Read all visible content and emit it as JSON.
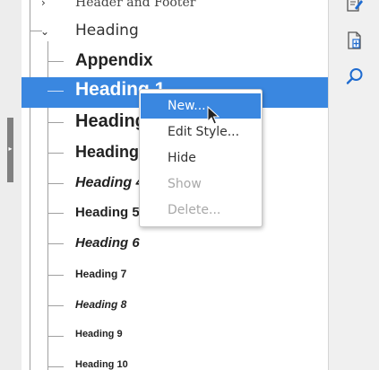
{
  "tree": {
    "parent_above": "Header and Footer",
    "expanded": "Heading",
    "children": [
      {
        "label": "Appendix"
      },
      {
        "label": "Heading 1"
      },
      {
        "label": "Heading 2"
      },
      {
        "label": "Heading 3"
      },
      {
        "label": "Heading 4"
      },
      {
        "label": "Heading 5"
      },
      {
        "label": "Heading 6"
      },
      {
        "label": "Heading 7"
      },
      {
        "label": "Heading 8"
      },
      {
        "label": "Heading 9"
      },
      {
        "label": "Heading 10"
      }
    ]
  },
  "context_menu": {
    "items": [
      {
        "label": "New...",
        "state": "highlighted"
      },
      {
        "label": "Edit Style...",
        "state": "enabled"
      },
      {
        "label": "Hide",
        "state": "enabled"
      },
      {
        "label": "Show",
        "state": "disabled"
      },
      {
        "label": "Delete...",
        "state": "disabled"
      }
    ]
  },
  "sidebar": {
    "icons": [
      "edit-style-icon",
      "new-style-from-selection-icon",
      "find-icon"
    ]
  },
  "colors": {
    "selection": "#3a87e0",
    "accent_icon": "#1e6bd0",
    "disabled_text": "#a8a8a8"
  }
}
